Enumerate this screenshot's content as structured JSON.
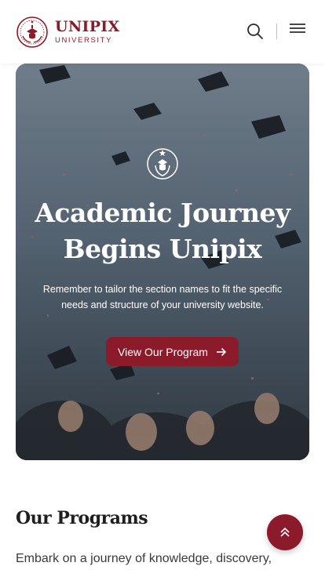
{
  "brand": {
    "name": "UNIPIX",
    "subtitle": "UNIVERSITY",
    "accent_color": "#8b1a2b"
  },
  "header": {
    "search_icon": "search-icon",
    "menu_icon": "hamburger-menu-icon"
  },
  "hero": {
    "title_line1": "Academic Journey",
    "title_line2": "Begins Unipix",
    "description": "Remember to tailor the section names to fit the specific needs and structure of your university website.",
    "cta_label": "View Our Program",
    "cta_icon": "arrow-right-icon",
    "emblem_icon": "university-emblem-icon"
  },
  "programs": {
    "title": "Our Programs",
    "description": "Embark on a journey of knowledge, discovery,"
  },
  "scroll_top": {
    "icon": "double-chevron-up-icon"
  }
}
